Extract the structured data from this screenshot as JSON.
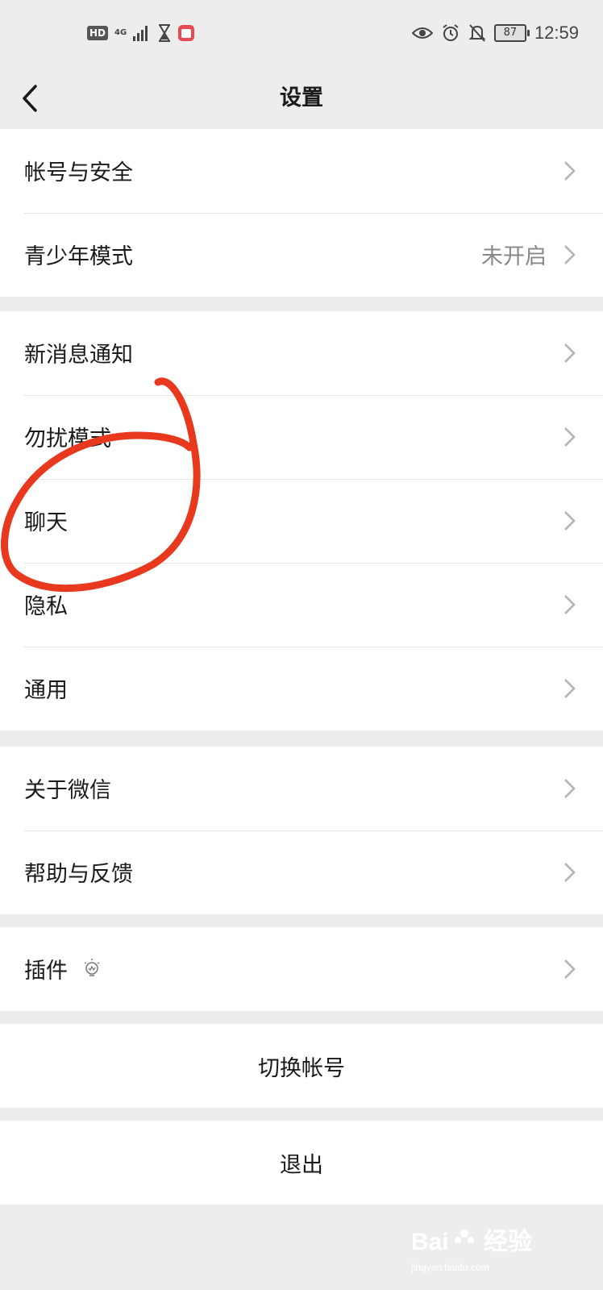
{
  "status_bar": {
    "hd_badge": "HD",
    "network_type": "4G",
    "battery_level": "87",
    "time": "12:59"
  },
  "header": {
    "title": "设置"
  },
  "groups": [
    {
      "items": [
        {
          "label": "帐号与安全",
          "value": ""
        },
        {
          "label": "青少年模式",
          "value": "未开启"
        }
      ]
    },
    {
      "items": [
        {
          "label": "新消息通知",
          "value": ""
        },
        {
          "label": "勿扰模式",
          "value": ""
        },
        {
          "label": "聊天",
          "value": ""
        },
        {
          "label": "隐私",
          "value": ""
        },
        {
          "label": "通用",
          "value": ""
        }
      ]
    },
    {
      "items": [
        {
          "label": "关于微信",
          "value": ""
        },
        {
          "label": "帮助与反馈",
          "value": ""
        }
      ]
    },
    {
      "items": [
        {
          "label": "插件",
          "value": "",
          "icon": "lightbulb-icon"
        }
      ]
    }
  ],
  "actions": {
    "switch_account": "切换帐号",
    "logout": "退出"
  },
  "watermark": {
    "brand": "Bai",
    "brand_suffix": "经验",
    "url": "jingyan.baidu.com"
  },
  "colors": {
    "background": "#ededed",
    "annotation": "#e8391f"
  }
}
